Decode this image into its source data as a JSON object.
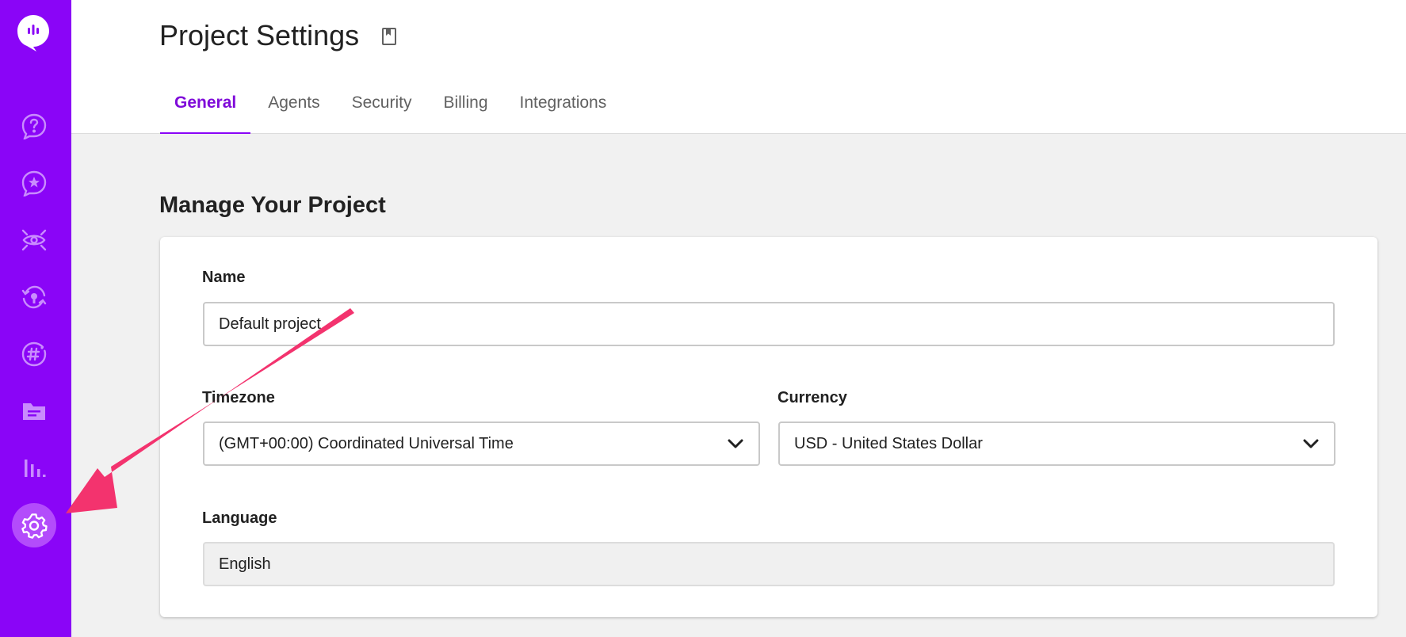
{
  "header": {
    "title": "Project Settings",
    "bookmark_icon": "bookmark-icon"
  },
  "tabs": [
    {
      "label": "General",
      "active": true
    },
    {
      "label": "Agents",
      "active": false
    },
    {
      "label": "Security",
      "active": false
    },
    {
      "label": "Billing",
      "active": false
    },
    {
      "label": "Integrations",
      "active": false
    }
  ],
  "sidebar": {
    "logo": "chat-logo-icon",
    "items": [
      {
        "icon": "help-icon"
      },
      {
        "icon": "star-chat-icon"
      },
      {
        "icon": "eye-icon"
      },
      {
        "icon": "bot-cycle-icon"
      },
      {
        "icon": "hashtag-icon"
      },
      {
        "icon": "folder-icon"
      },
      {
        "icon": "bar-chart-icon"
      },
      {
        "icon": "gear-icon",
        "active": true
      }
    ],
    "accent_color": "#8A05F7"
  },
  "main": {
    "section_title": "Manage Your Project",
    "name": {
      "label": "Name",
      "value": "Default project"
    },
    "timezone": {
      "label": "Timezone",
      "value": "(GMT+00:00) Coordinated Universal Time"
    },
    "currency": {
      "label": "Currency",
      "value": "USD - United States Dollar"
    },
    "language": {
      "label": "Language",
      "value": "English"
    }
  },
  "annotation": {
    "type": "arrow",
    "color": "#F3336E",
    "points_to": "gear-icon"
  }
}
